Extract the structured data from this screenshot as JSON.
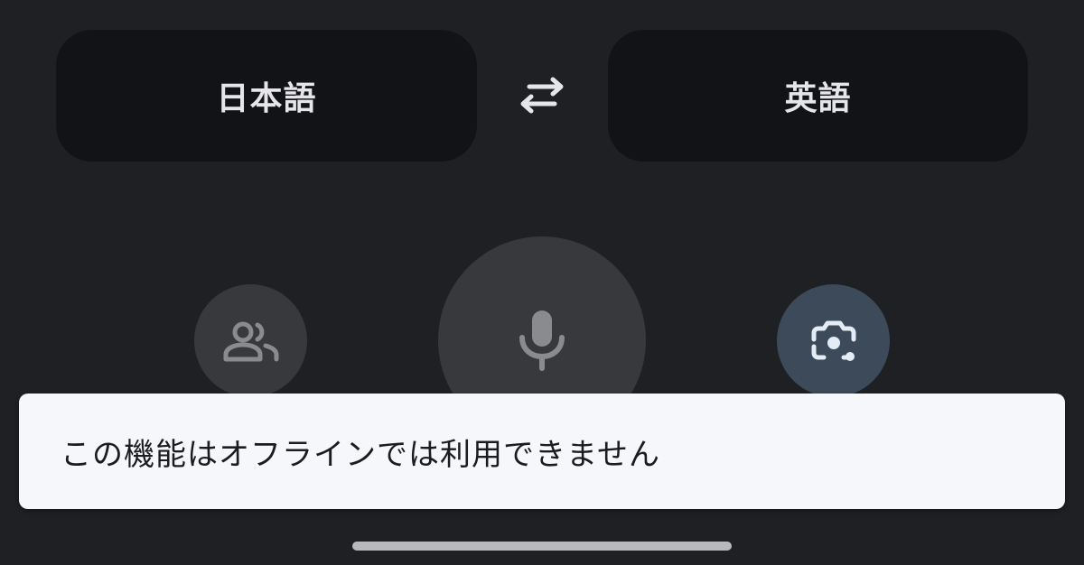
{
  "languages": {
    "source": "日本語",
    "target": "英語"
  },
  "icons": {
    "swap": "swap-arrows-icon",
    "conversation": "people-icon",
    "mic": "microphone-icon",
    "camera": "camera-lens-icon"
  },
  "snackbar": {
    "message": "この機能はオフラインでは利用できません"
  },
  "colors": {
    "background": "#1f2024",
    "language_button": "#111317",
    "circle_button": "#38393d",
    "camera_button": "#3c4a5a",
    "snackbar": "#f6f7fb"
  }
}
